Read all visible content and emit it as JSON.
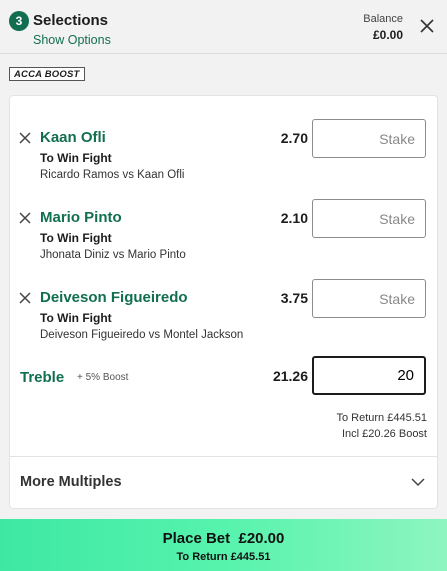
{
  "header": {
    "count": "3",
    "title": "Selections",
    "show_options": "Show Options",
    "balance_label": "Balance",
    "balance_value": "£0.00"
  },
  "acca_badge": "ACCA BOOST",
  "selections": [
    {
      "name": "Kaan Ofli",
      "market": "To Win Fight",
      "event": "Ricardo Ramos vs Kaan Ofli",
      "odds": "2.70",
      "stake_placeholder": "Stake"
    },
    {
      "name": "Mario Pinto",
      "market": "To Win Fight",
      "event": "Jhonata Diniz vs Mario Pinto",
      "odds": "2.10",
      "stake_placeholder": "Stake"
    },
    {
      "name": "Deiveson Figueiredo",
      "market": "To Win Fight",
      "event": "Deiveson Figueiredo vs Montel Jackson",
      "odds": "3.75",
      "stake_placeholder": "Stake"
    }
  ],
  "treble": {
    "name": "Treble",
    "boost": "+ 5% Boost",
    "odds": "21.26",
    "stake_value": "20",
    "to_return": "To Return £445.51",
    "incl_boost": "Incl £20.26 Boost"
  },
  "more_multiples": "More Multiples",
  "place_bet": {
    "label": "Place Bet  £20.00",
    "to_return": "To Return £445.51"
  },
  "colors": {
    "accent_green": "#126e51",
    "place_bet_gradient_start": "#3ee8a3",
    "place_bet_gradient_end": "#8ef5c1"
  },
  "icons": [
    "close-icon",
    "remove-selection-icon",
    "chevron-down-icon"
  ]
}
